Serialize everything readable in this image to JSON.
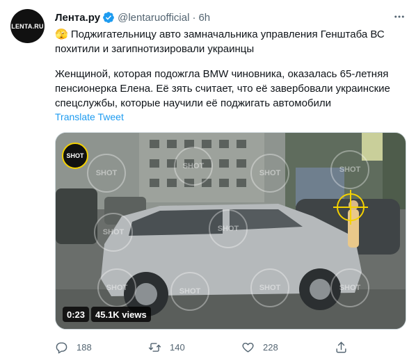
{
  "account": {
    "name": "Лента.ру",
    "handle": "@lentaruofficial",
    "separator": "·",
    "time": "6h",
    "avatar_text": "LENTA.RU"
  },
  "tweet": {
    "line1": "🫣 Поджигательницу авто замначальника управления Генштаба ВС",
    "line2": "похитили и загипнотизировали украинцы",
    "line3": "Женщиной, которая подожгла BMW чиновника, оказалась 65-летняя",
    "line4": "пенсионерка Елена. Её зять считает, что её завербовали украинские",
    "line5": "спецслужбы, которые научили её поджигать автомобили",
    "translate": "Translate Tweet"
  },
  "media": {
    "badge": "SHOT",
    "watermark": "SHOT",
    "duration": "0:23",
    "views": "45.1K views"
  },
  "actions": {
    "replies": "188",
    "retweets": "140",
    "likes": "228"
  },
  "icons": {
    "verified": "verified-badge-icon",
    "more": "more-icon",
    "reply": "reply-icon",
    "retweet": "retweet-icon",
    "like": "heart-icon",
    "share": "share-icon"
  },
  "colors": {
    "accent": "#1d9bf0",
    "muted": "#536471",
    "text": "#0f1419",
    "badge_ring": "#f5d200"
  }
}
